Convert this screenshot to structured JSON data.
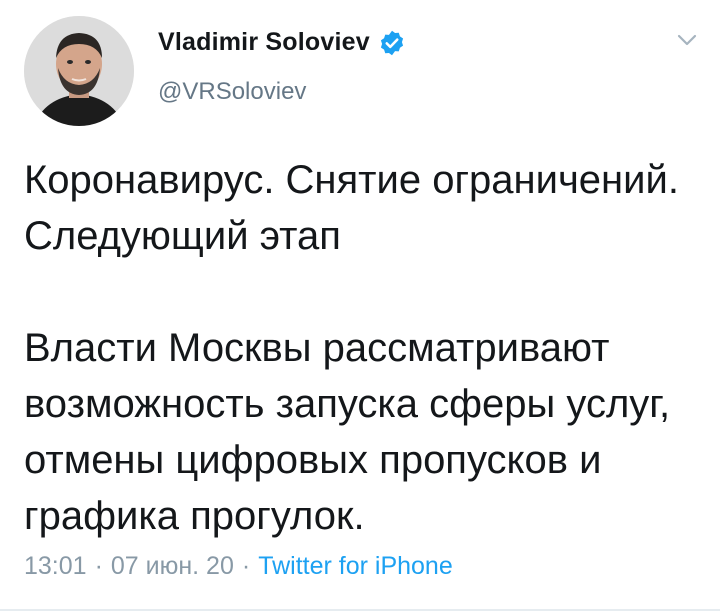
{
  "tweet": {
    "author": {
      "display_name": "Vladimir Soloviev",
      "handle": "@VRSoloviev",
      "verified": true
    },
    "text": "Коронавирус. Снятие ограничений. Следующий этап\n\nВласти Москвы рассматривают возможность запуска сферы услуг, отмены цифровых пропусков и графика прогулок.",
    "time": "13:01",
    "date": "07 июн. 20",
    "source": "Twitter for iPhone",
    "separator": "·"
  },
  "colors": {
    "verified_badge": "#1da1f2",
    "source_link": "#1da1f2",
    "meta_text": "#8899a6",
    "handle_text": "#657786"
  },
  "icons": {
    "verified": "verified-badge-icon",
    "caret": "chevron-down-icon"
  }
}
